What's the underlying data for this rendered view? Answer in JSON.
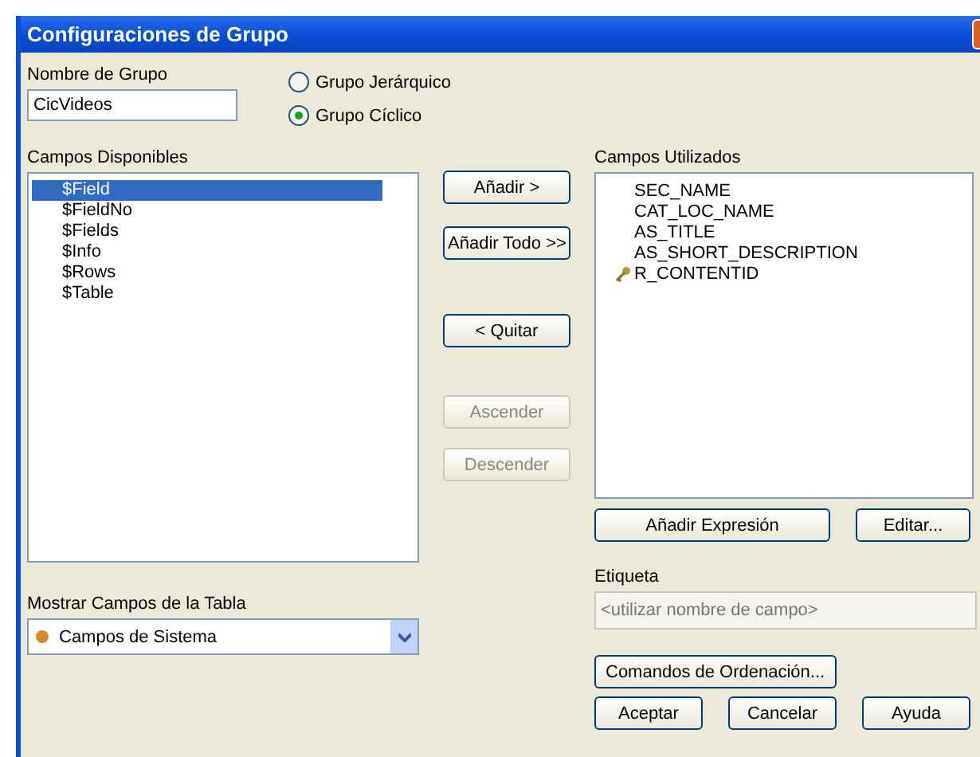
{
  "window": {
    "title": "Configuraciones de Grupo"
  },
  "group_name": {
    "label": "Nombre de Grupo",
    "value": "CicVideos"
  },
  "group_type": [
    {
      "label": "Grupo Jerárquico",
      "selected": false
    },
    {
      "label": "Grupo Cíclico",
      "selected": true
    }
  ],
  "available_fields": {
    "label": "Campos Disponibles",
    "items": [
      {
        "text": "$Field",
        "selected": true
      },
      {
        "text": "$FieldNo",
        "selected": false
      },
      {
        "text": "$Fields",
        "selected": false
      },
      {
        "text": "$Info",
        "selected": false
      },
      {
        "text": "$Rows",
        "selected": false
      },
      {
        "text": "$Table",
        "selected": false
      }
    ]
  },
  "move_buttons": [
    {
      "label": "Añadir >",
      "disabled": false
    },
    {
      "label": "Añadir Todo >>",
      "disabled": false
    },
    {
      "label": "< Quitar",
      "disabled": false
    },
    {
      "label": "Ascender",
      "disabled": true
    },
    {
      "label": "Descender",
      "disabled": true
    }
  ],
  "used_fields": {
    "label": "Campos Utilizados",
    "items": [
      {
        "text": "SEC_NAME",
        "kind": "field"
      },
      {
        "text": "CAT_LOC_NAME",
        "kind": "field"
      },
      {
        "text": "AS_TITLE",
        "kind": "field"
      },
      {
        "text": "AS_SHORT_DESCRIPTION",
        "kind": "field"
      },
      {
        "text": "R_CONTENTID",
        "kind": "key"
      }
    ]
  },
  "expression_buttons": [
    "Añadir Expresión",
    "Editar..."
  ],
  "label_field": {
    "label": "Etiqueta",
    "placeholder": "<utilizar nombre de campo>",
    "disabled": true
  },
  "table_fields": {
    "label": "Mostrar Campos de la Tabla",
    "value": "Campos de Sistema"
  },
  "sort_button": "Comandos de Ordenación...",
  "dialog_buttons": [
    "Aceptar",
    "Cancelar",
    "Ayuda"
  ]
}
